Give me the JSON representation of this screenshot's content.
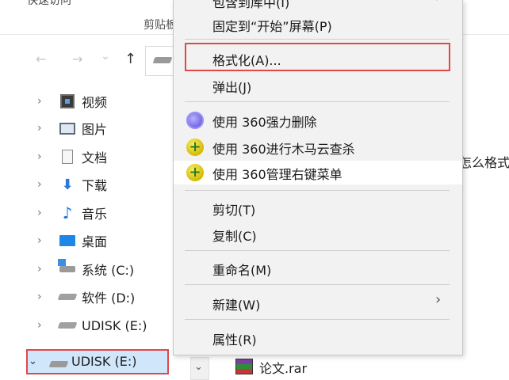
{
  "explorer": {
    "top_text": "快速访问",
    "clipboard_label": "剪贴板"
  },
  "nav": {
    "back_icon": "←",
    "forward_icon": "→",
    "recent_icon": "⌄",
    "up_icon": "↑"
  },
  "tree": [
    {
      "label": "视频",
      "icon": "video-icon"
    },
    {
      "label": "图片",
      "icon": "pictures-icon"
    },
    {
      "label": "文档",
      "icon": "documents-icon"
    },
    {
      "label": "下载",
      "icon": "downloads-icon"
    },
    {
      "label": "音乐",
      "icon": "music-icon"
    },
    {
      "label": "桌面",
      "icon": "desktop-icon"
    },
    {
      "label": "系统 (C:)",
      "icon": "system-drive-icon"
    },
    {
      "label": "软件 (D:)",
      "icon": "drive-icon"
    },
    {
      "label": "UDISK (E:)",
      "icon": "usb-drive-icon"
    }
  ],
  "selected_drive": {
    "label": "UDISK (E:)",
    "chevron": "⌄"
  },
  "right_pane": {
    "partial_text": "怎么格式",
    "file_name": "论文.rar"
  },
  "context_menu": {
    "partial_top": "包含到库中(I)",
    "pin_start": "固定到“开始”屏幕(P)",
    "format": "格式化(A)...",
    "eject": "弹出(J)",
    "force_delete_360": "使用 360强力删除",
    "trojan_scan_360": "使用 360进行木马云查杀",
    "manage_menu_360": "使用 360管理右键菜单",
    "cut": "剪切(T)",
    "copy": "复制(C)",
    "rename": "重命名(M)",
    "new": "新建(W)",
    "properties": "属性(R)",
    "submenu_arrow": "›"
  },
  "colors": {
    "highlight_red": "#e24848",
    "selection_blue": "#cfe6fb",
    "menu_bg": "#f2f2f2"
  }
}
